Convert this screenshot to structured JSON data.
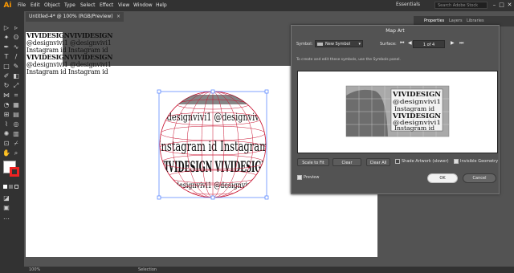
{
  "menubar": {
    "logo": "Ai",
    "items": [
      "File",
      "Edit",
      "Object",
      "Type",
      "Select",
      "Effect",
      "View",
      "Window",
      "Help"
    ],
    "workspace": "Essentials",
    "search_placeholder": "Search Adobe Stock",
    "win_min": "–",
    "win_max": "□",
    "win_close": "✕"
  },
  "document_tab": {
    "title": "Untitled-4* @ 100% (RGB/Preview)",
    "close": "×"
  },
  "panel_tabs": {
    "properties": "Properties",
    "layers": "Layers",
    "libraries": "Libraries"
  },
  "canvas_text": {
    "line1": "VIVIDESIGNVIVIDESIGN",
    "line2": "@designvivi1 @designvivi1",
    "line3": "Instagram id  Instagram id",
    "line4": "VIVIDESIGNVIVIDESIGN",
    "line5": "@designvivi1 @designvivi1",
    "line6": "Instagram id  Instagram id"
  },
  "status": {
    "zoom": "100%",
    "tool": "Selection"
  },
  "dialog": {
    "title": "Map Art",
    "symbol_label": "Symbol:",
    "symbol_value": "New Symbol",
    "surface_label": "Surface:",
    "page_value": "1 of 4",
    "hint": "To create and edit these symbols, use the Symbols panel.",
    "scale_to_fit": "Scale to Fit",
    "clear": "Clear",
    "clear_all": "Clear All",
    "shade_artwork": "Shade Artwork (slower)",
    "invisible_geometry": "Invisible Geometry",
    "preview": "Preview",
    "ok": "OK",
    "cancel": "Cancel"
  },
  "preview_symbol": {
    "line1": "VIVIDESIGN",
    "line2": "@designvivi1",
    "line3": "Instagram id"
  },
  "sphere_text": {
    "row1": "@designvivi1 @designvivi1",
    "row2": "Instagram id  Instagram",
    "row3": "VIVIDESIGN VIVIDESIGN",
    "row4": "@designvivi1 @designvivi1"
  },
  "colors": {
    "accent": "#ff9a00",
    "wireframe": "#c8102e",
    "selection": "#4a7cff"
  }
}
